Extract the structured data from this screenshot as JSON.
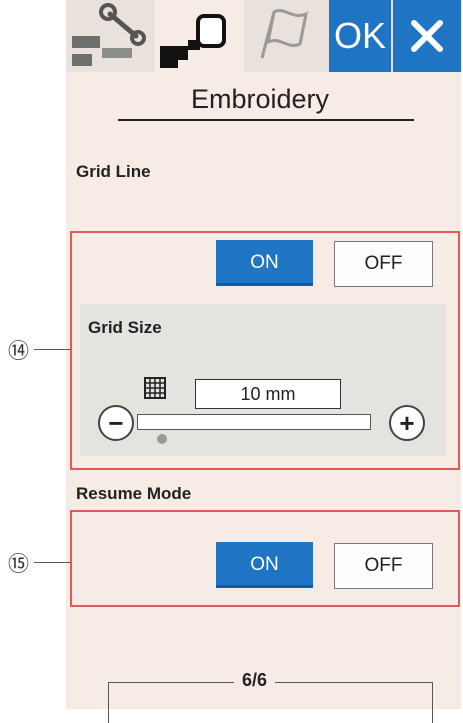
{
  "header": {
    "tabs": [
      {
        "name": "machine-settings",
        "icon": "wrench-icon"
      },
      {
        "name": "embroidery-settings",
        "icon": "embroidery-hoop-icon",
        "active": true
      },
      {
        "name": "language-settings",
        "icon": "flag-icon"
      }
    ],
    "ok_label": "OK",
    "close_icon": "close-icon"
  },
  "title": "Embroidery",
  "grid_line": {
    "label": "Grid Line",
    "on_label": "ON",
    "off_label": "OFF",
    "selected": "ON",
    "callout": "⑭"
  },
  "grid_size": {
    "label": "Grid Size",
    "value": "10 mm",
    "slider_level": 0,
    "minus_icon": "minus-icon",
    "plus_icon": "plus-icon",
    "grid_icon": "grid-icon"
  },
  "resume_mode": {
    "label": "Resume Mode",
    "on_label": "ON",
    "off_label": "OFF",
    "selected": "ON",
    "callout": "⑮"
  },
  "footer": {
    "page": "6/6"
  },
  "colors": {
    "accent": "#1f74c4",
    "panel": "#f7ebe6",
    "highlight": "#e05a5a"
  }
}
